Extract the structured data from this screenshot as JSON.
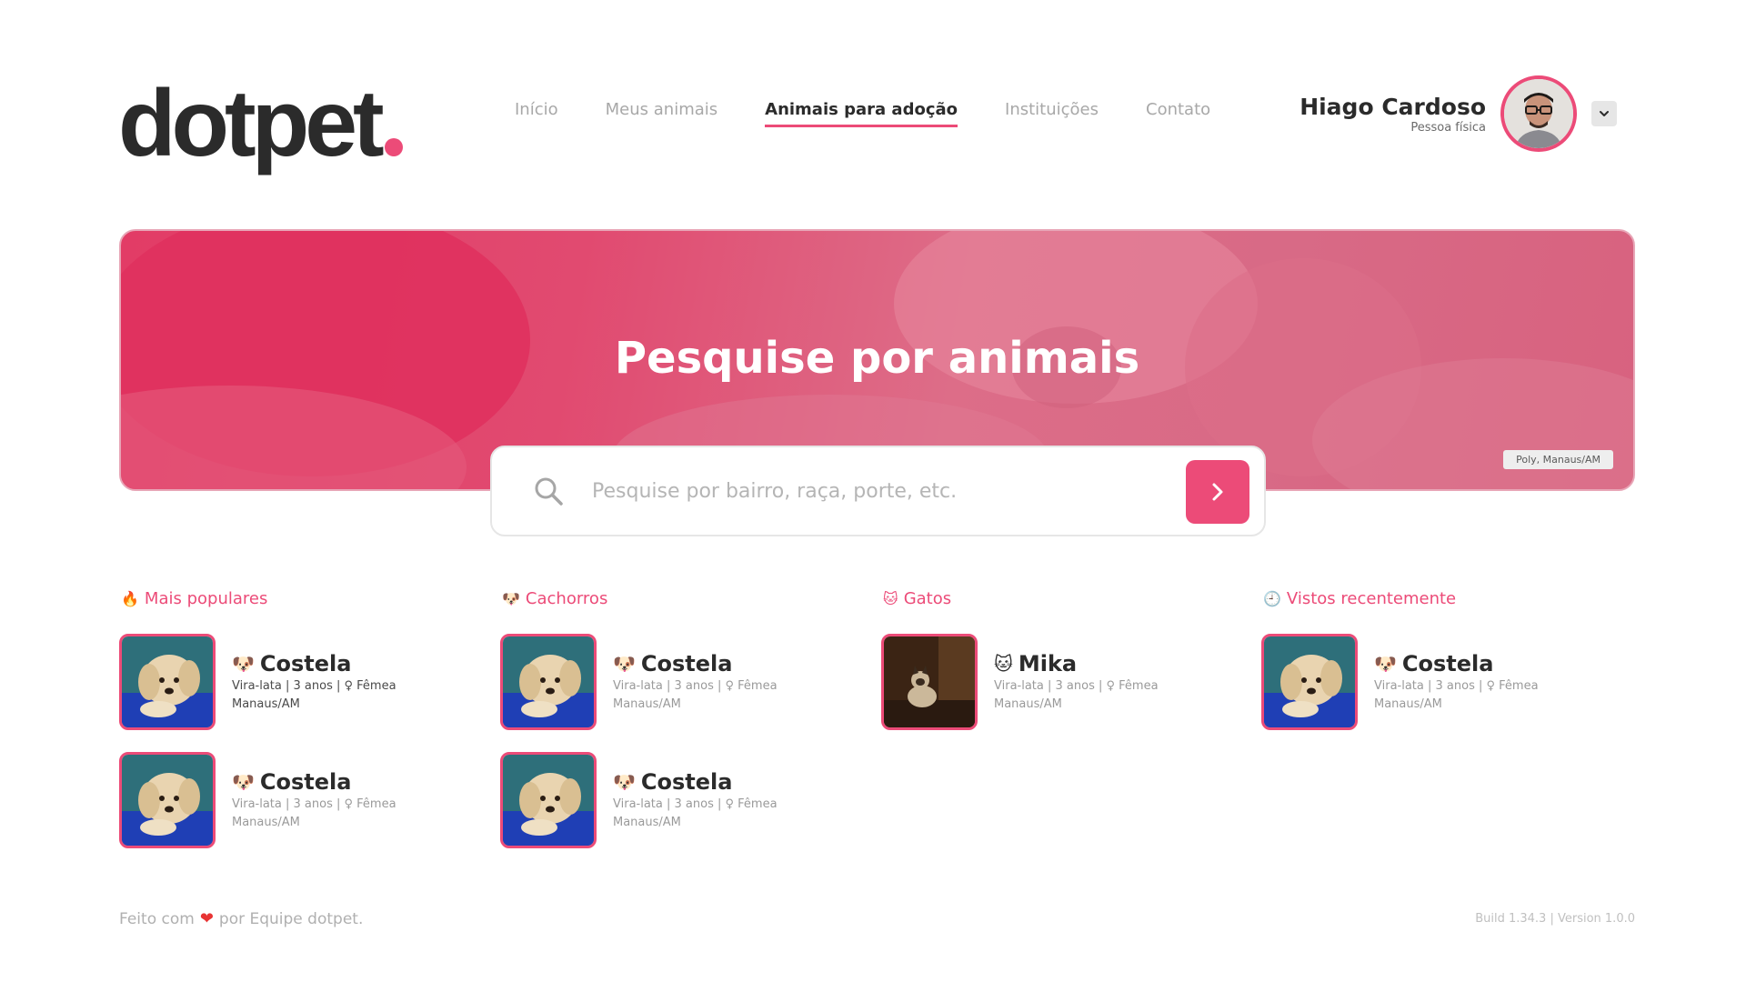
{
  "brand": {
    "name": "dotpet",
    "accent": "#ec4b78",
    "dark": "#2b2b2b"
  },
  "nav": {
    "items": [
      {
        "label": "Início",
        "active": false
      },
      {
        "label": "Meus animais",
        "active": false
      },
      {
        "label": "Animais para adoção",
        "active": true
      },
      {
        "label": "Instituições",
        "active": false
      },
      {
        "label": "Contato",
        "active": false
      }
    ]
  },
  "user": {
    "name": "Hiago Cardoso",
    "type": "Pessoa física",
    "dropdown_icon": "chevron-down-icon"
  },
  "hero": {
    "title": "Pesquise por animais",
    "caption": "Poly, Manaus/AM"
  },
  "search": {
    "placeholder": "Pesquise por bairro, raça, porte, etc.",
    "value": ""
  },
  "columns": [
    {
      "title": "Mais populares",
      "emoji": "🔥",
      "cards": [
        {
          "emoji": "🐶",
          "name": "Costela",
          "details": "Vira-lata | 3 anos | ♀ Fêmea",
          "location": "Manaus/AM",
          "photo": "dog"
        },
        {
          "emoji": "🐶",
          "name": "Costela",
          "details": "Vira-lata | 3 anos | ♀ Fêmea",
          "location": "Manaus/AM",
          "photo": "dog"
        }
      ]
    },
    {
      "title": "Cachorros",
      "emoji": "🐶",
      "cards": [
        {
          "emoji": "🐶",
          "name": "Costela",
          "details": "Vira-lata | 3 anos | ♀ Fêmea",
          "location": "Manaus/AM",
          "photo": "dog"
        },
        {
          "emoji": "🐶",
          "name": "Costela",
          "details": "Vira-lata | 3 anos | ♀ Fêmea",
          "location": "Manaus/AM",
          "photo": "dog"
        }
      ]
    },
    {
      "title": "Gatos",
      "emoji": "🐱",
      "cards": [
        {
          "emoji": "🐱",
          "name": "Mika",
          "details": "Vira-lata | 3 anos | ♀ Fêmea",
          "location": "Manaus/AM",
          "photo": "cat"
        }
      ]
    },
    {
      "title": "Vistos recentemente",
      "emoji": "🕘",
      "cards": [
        {
          "emoji": "🐶",
          "name": "Costela",
          "details": "Vira-lata | 3 anos | ♀ Fêmea",
          "location": "Manaus/AM",
          "photo": "dog"
        }
      ]
    }
  ],
  "footer": {
    "made_prefix": "Feito com",
    "heart": "❤",
    "made_suffix": "por Equipe dotpet.",
    "build": "Build 1.34.3 | Version 1.0.0"
  }
}
